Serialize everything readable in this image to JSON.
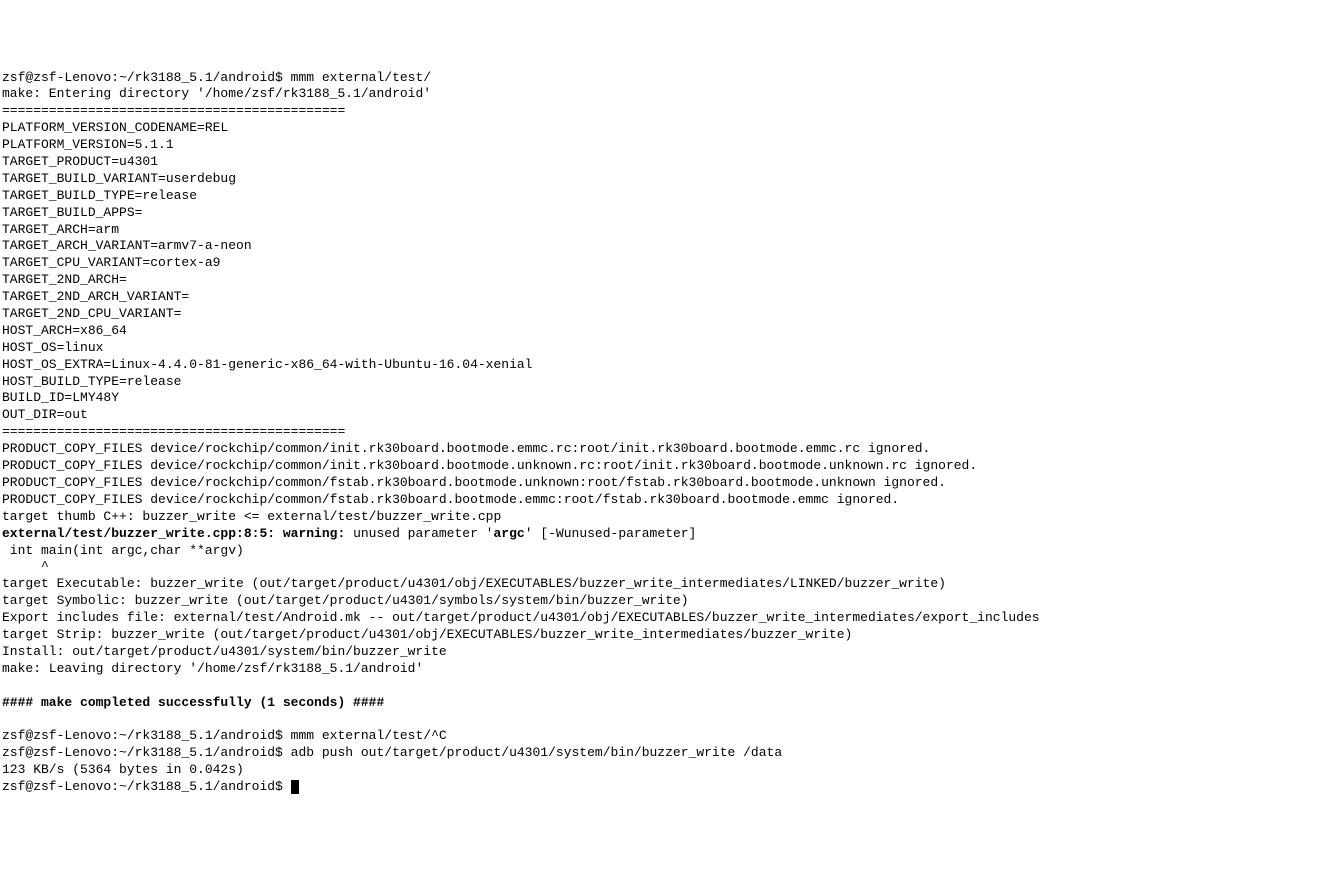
{
  "lines": [
    {
      "text": "zsf@zsf-Lenovo:~/rk3188_5.1/android$ mmm external/test/",
      "bold": false
    },
    {
      "text": "make: Entering directory '/home/zsf/rk3188_5.1/android'",
      "bold": false
    },
    {
      "text": "============================================",
      "bold": false
    },
    {
      "text": "PLATFORM_VERSION_CODENAME=REL",
      "bold": false
    },
    {
      "text": "PLATFORM_VERSION=5.1.1",
      "bold": false
    },
    {
      "text": "TARGET_PRODUCT=u4301",
      "bold": false
    },
    {
      "text": "TARGET_BUILD_VARIANT=userdebug",
      "bold": false
    },
    {
      "text": "TARGET_BUILD_TYPE=release",
      "bold": false
    },
    {
      "text": "TARGET_BUILD_APPS=",
      "bold": false
    },
    {
      "text": "TARGET_ARCH=arm",
      "bold": false
    },
    {
      "text": "TARGET_ARCH_VARIANT=armv7-a-neon",
      "bold": false
    },
    {
      "text": "TARGET_CPU_VARIANT=cortex-a9",
      "bold": false
    },
    {
      "text": "TARGET_2ND_ARCH=",
      "bold": false
    },
    {
      "text": "TARGET_2ND_ARCH_VARIANT=",
      "bold": false
    },
    {
      "text": "TARGET_2ND_CPU_VARIANT=",
      "bold": false
    },
    {
      "text": "HOST_ARCH=x86_64",
      "bold": false
    },
    {
      "text": "HOST_OS=linux",
      "bold": false
    },
    {
      "text": "HOST_OS_EXTRA=Linux-4.4.0-81-generic-x86_64-with-Ubuntu-16.04-xenial",
      "bold": false
    },
    {
      "text": "HOST_BUILD_TYPE=release",
      "bold": false
    },
    {
      "text": "BUILD_ID=LMY48Y",
      "bold": false
    },
    {
      "text": "OUT_DIR=out",
      "bold": false
    },
    {
      "text": "============================================",
      "bold": false
    },
    {
      "text": "PRODUCT_COPY_FILES device/rockchip/common/init.rk30board.bootmode.emmc.rc:root/init.rk30board.bootmode.emmc.rc ignored.",
      "bold": false
    },
    {
      "text": "PRODUCT_COPY_FILES device/rockchip/common/init.rk30board.bootmode.unknown.rc:root/init.rk30board.bootmode.unknown.rc ignored.",
      "bold": false
    },
    {
      "text": "PRODUCT_COPY_FILES device/rockchip/common/fstab.rk30board.bootmode.unknown:root/fstab.rk30board.bootmode.unknown ignored.",
      "bold": false
    },
    {
      "text": "PRODUCT_COPY_FILES device/rockchip/common/fstab.rk30board.bootmode.emmc:root/fstab.rk30board.bootmode.emmc ignored.",
      "bold": false
    },
    {
      "text": "target thumb C++: buzzer_write <= external/test/buzzer_write.cpp",
      "bold": false
    }
  ],
  "warning_line": {
    "prefix": "external/test/buzzer_write.cpp:8:5: warning: ",
    "middle": "unused parameter '",
    "argc": "argc",
    "suffix": "' [-Wunused-parameter]"
  },
  "after_warning": [
    {
      "text": " int main(int argc,char **argv)",
      "bold": false
    },
    {
      "text": "     ^",
      "bold": false
    },
    {
      "text": "target Executable: buzzer_write (out/target/product/u4301/obj/EXECUTABLES/buzzer_write_intermediates/LINKED/buzzer_write)",
      "bold": false
    },
    {
      "text": "target Symbolic: buzzer_write (out/target/product/u4301/symbols/system/bin/buzzer_write)",
      "bold": false
    },
    {
      "text": "Export includes file: external/test/Android.mk -- out/target/product/u4301/obj/EXECUTABLES/buzzer_write_intermediates/export_includes",
      "bold": false
    },
    {
      "text": "target Strip: buzzer_write (out/target/product/u4301/obj/EXECUTABLES/buzzer_write_intermediates/buzzer_write)",
      "bold": false
    },
    {
      "text": "Install: out/target/product/u4301/system/bin/buzzer_write",
      "bold": false
    },
    {
      "text": "make: Leaving directory '/home/zsf/rk3188_5.1/android'",
      "bold": false
    },
    {
      "text": "",
      "bold": false
    },
    {
      "text": "#### make completed successfully (1 seconds) ####",
      "bold": true
    },
    {
      "text": "",
      "bold": false
    },
    {
      "text": "zsf@zsf-Lenovo:~/rk3188_5.1/android$ mmm external/test/^C",
      "bold": false
    },
    {
      "text": "zsf@zsf-Lenovo:~/rk3188_5.1/android$ adb push out/target/product/u4301/system/bin/buzzer_write /data",
      "bold": false
    },
    {
      "text": "123 KB/s (5364 bytes in 0.042s)",
      "bold": false
    }
  ],
  "prompt_final": "zsf@zsf-Lenovo:~/rk3188_5.1/android$ "
}
